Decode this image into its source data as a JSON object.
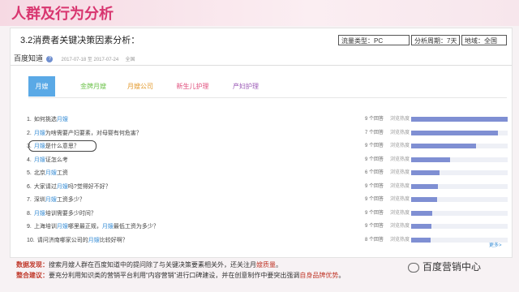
{
  "header": {
    "title": "人群及行为分析"
  },
  "section": {
    "title": "3.2消费者关键决策因素分析："
  },
  "meta": {
    "traffic_type": "流量类型：PC",
    "period": "分析周期：7天",
    "region": "地域：全国"
  },
  "baidu": {
    "brand": "百度知道",
    "date_range": "2017-07-18 至 2017-07-24",
    "scope": "全国"
  },
  "tabs": [
    {
      "label": "月嫂"
    },
    {
      "label": "金牌月嫂"
    },
    {
      "label": "月嫂公司"
    },
    {
      "label": "新生儿护理"
    },
    {
      "label": "产妇护理"
    }
  ],
  "rows": [
    {
      "num": "1.",
      "pre": "如何挑选",
      "kw": "月嫂",
      "post": "",
      "answers": "9 个回答",
      "heat_label": "浏览热度",
      "heat": 1.0
    },
    {
      "num": "2.",
      "pre": "",
      "kw": "月嫂",
      "post": "为啥需要产妇要素，对母婴有何危害？",
      "answers": "7 个回答",
      "heat_label": "浏览热度",
      "heat": 0.9
    },
    {
      "num": "3.",
      "pre": "",
      "kw": "月嫂",
      "post": "是什么意思？",
      "answers": "9 个回答",
      "heat_label": "浏览热度",
      "heat": 0.67
    },
    {
      "num": "4.",
      "pre": "",
      "kw": "月嫂",
      "post": "证怎么考",
      "answers": "9 个回答",
      "heat_label": "浏览热度",
      "heat": 0.4
    },
    {
      "num": "5.",
      "pre": "北京",
      "kw": "月嫂",
      "post": "工资",
      "answers": "6 个回答",
      "heat_label": "浏览热度",
      "heat": 0.29
    },
    {
      "num": "6.",
      "pre": "大家请过",
      "kw": "月嫂",
      "post": "吗?觉得好不好？",
      "answers": "9 个回答",
      "heat_label": "浏览热度",
      "heat": 0.28
    },
    {
      "num": "7.",
      "pre": "深圳",
      "kw": "月嫂",
      "post": "工资多少？",
      "answers": "9 个回答",
      "heat_label": "浏览热度",
      "heat": 0.27
    },
    {
      "num": "8.",
      "pre": "",
      "kw": "月嫂",
      "post": "培训需要多少时间？",
      "answers": "9 个回答",
      "heat_label": "浏览热度",
      "heat": 0.22
    },
    {
      "num": "9.",
      "pre": "上海培训",
      "kw": "月嫂",
      "post": "哪里最正规，",
      "kw2": "月嫂",
      "post2": "最低工资为多少？",
      "answers": "9 个回答",
      "heat_label": "浏览热度",
      "heat": 0.21
    },
    {
      "num": "10.",
      "pre": "请问济南哪家公司的",
      "kw": "月嫂",
      "post": "比较好啊？",
      "answers": "8 个回答",
      "heat_label": "浏览热度",
      "heat": 0.2
    }
  ],
  "more_link": "更多>",
  "footer": {
    "line1_label": "数据发现：",
    "line1_text": "搜索月嫂人群在百度知道中的提问除了与关键决策要素相关外，还关注月",
    "line1_hl": "嫂质量",
    "line1_end": "。",
    "line2_label": "整合建议：",
    "line2_text": "要充分利用知识类的营销平台利用“内容营销”进行口碑建设，并在创意制作中要突出强调",
    "line2_hl": "自身品牌优势",
    "line2_end": "。"
  },
  "watermark": {
    "text": "百度营销中心"
  },
  "colors": {
    "title": "#d8356f",
    "tab_active": "#5aa9e6",
    "bar": "#7f8fd3",
    "highlight": "#c0392b"
  }
}
